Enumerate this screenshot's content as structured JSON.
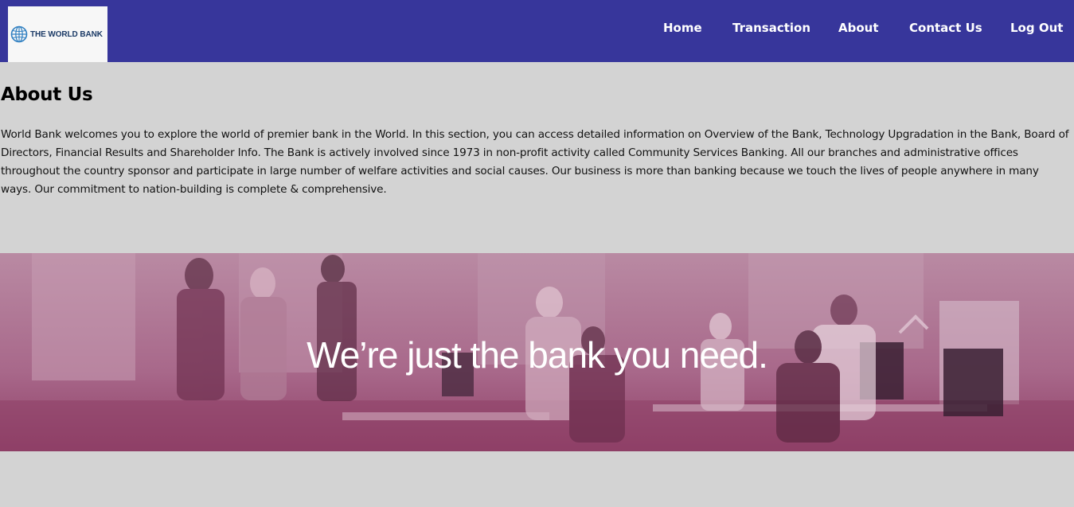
{
  "brand": {
    "logo_text": "THE WORLD BANK",
    "logo_icon": "globe-icon",
    "nav_color": "#37369b"
  },
  "nav": {
    "items": [
      {
        "label": "Home"
      },
      {
        "label": "Transaction"
      },
      {
        "label": "About"
      },
      {
        "label": "Contact Us"
      },
      {
        "label": "Log Out"
      }
    ]
  },
  "main": {
    "title": "About Us",
    "body": "World Bank welcomes you to explore the world of premier bank in the World. In this section, you can access detailed information on Overview of the Bank, Technology Upgradation in the Bank, Board of Directors, Financial Results and Shareholder Info. The Bank is actively involved since 1973 in non-profit activity called Community Services Banking. All our branches and administrative offices throughout the country sponsor and participate in large number of welfare activities and social causes. Our business is more than banking because we touch the lives of people anywhere in many ways. Our commitment to nation-building is complete & comprehensive."
  },
  "hero": {
    "tagline": "We’re just the bank you need.",
    "overlay_color": "#a8587e"
  }
}
